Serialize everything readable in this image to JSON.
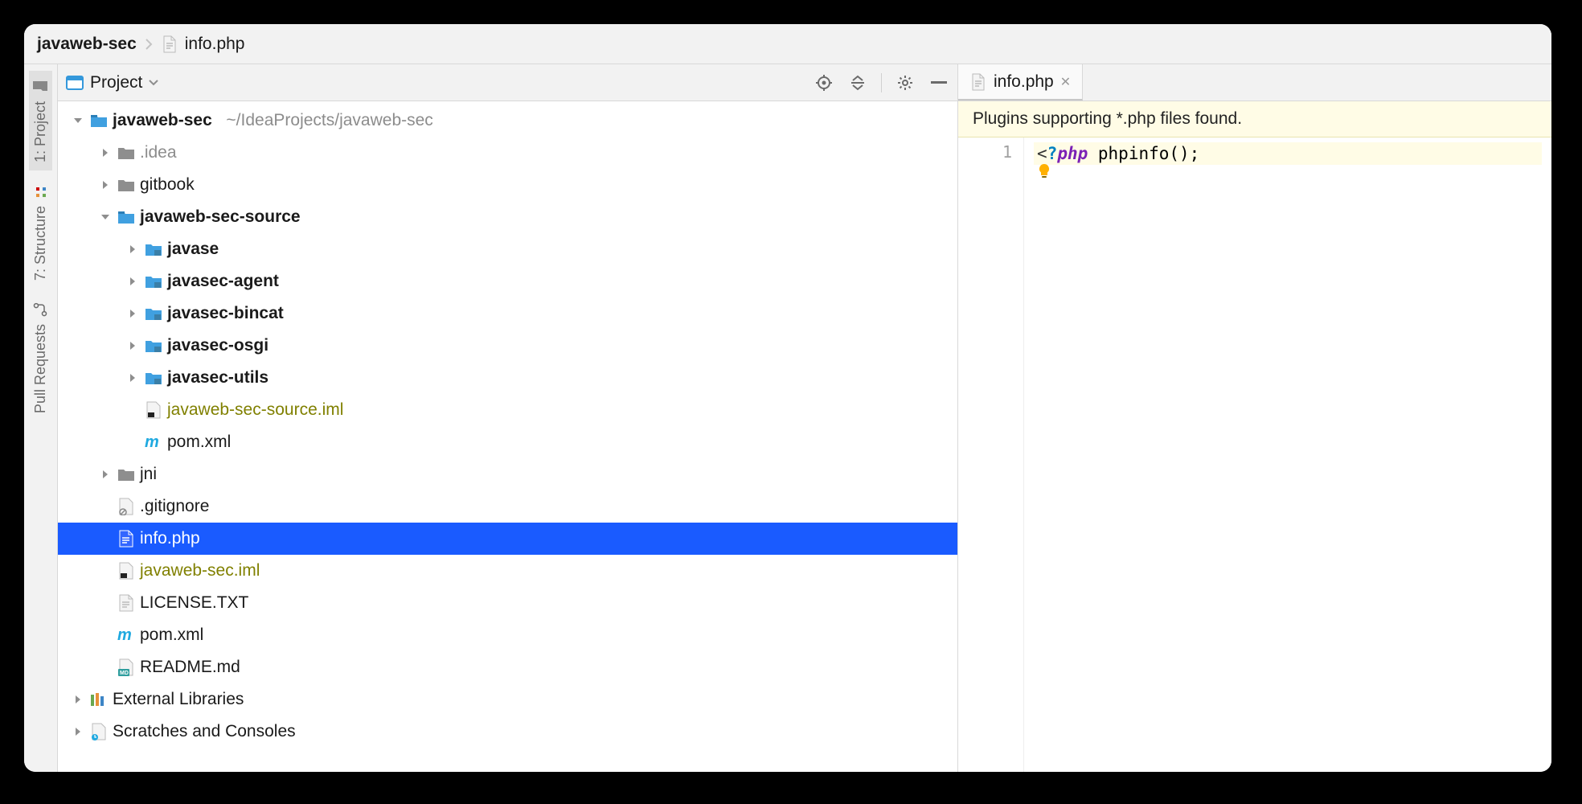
{
  "breadcrumb": {
    "project": "javaweb-sec",
    "file": "info.php"
  },
  "toolstrip": {
    "tabs": [
      {
        "label": "1: Project"
      },
      {
        "label": "7: Structure"
      },
      {
        "label": "Pull Requests"
      }
    ]
  },
  "project_panel": {
    "title": "Project",
    "tree": {
      "root": {
        "name": "javaweb-sec",
        "path": "~/IdeaProjects/javaweb-sec"
      },
      "items": [
        {
          "name": ".idea",
          "depth": 1,
          "expanded": false,
          "kind": "folder-gray",
          "muted": true
        },
        {
          "name": "gitbook",
          "depth": 1,
          "expanded": false,
          "kind": "folder-gray"
        },
        {
          "name": "javaweb-sec-source",
          "depth": 1,
          "expanded": true,
          "kind": "folder-blue",
          "bold": true
        },
        {
          "name": "javase",
          "depth": 2,
          "expanded": false,
          "kind": "module",
          "bold": true
        },
        {
          "name": "javasec-agent",
          "depth": 2,
          "expanded": false,
          "kind": "module",
          "bold": true
        },
        {
          "name": "javasec-bincat",
          "depth": 2,
          "expanded": false,
          "kind": "module",
          "bold": true
        },
        {
          "name": "javasec-osgi",
          "depth": 2,
          "expanded": false,
          "kind": "module",
          "bold": true
        },
        {
          "name": "javasec-utils",
          "depth": 2,
          "expanded": false,
          "kind": "module",
          "bold": true
        },
        {
          "name": "javaweb-sec-source.iml",
          "depth": 2,
          "leaf": true,
          "kind": "iml",
          "olive": true
        },
        {
          "name": "pom.xml",
          "depth": 2,
          "leaf": true,
          "kind": "maven"
        },
        {
          "name": "jni",
          "depth": 1,
          "expanded": false,
          "kind": "folder-gray"
        },
        {
          "name": ".gitignore",
          "depth": 1,
          "leaf": true,
          "kind": "gitignore"
        },
        {
          "name": "info.php",
          "depth": 1,
          "leaf": true,
          "kind": "file",
          "selected": true
        },
        {
          "name": "javaweb-sec.iml",
          "depth": 1,
          "leaf": true,
          "kind": "iml",
          "olive": true
        },
        {
          "name": "LICENSE.TXT",
          "depth": 1,
          "leaf": true,
          "kind": "file"
        },
        {
          "name": "pom.xml",
          "depth": 1,
          "leaf": true,
          "kind": "maven"
        },
        {
          "name": "README.md",
          "depth": 1,
          "leaf": true,
          "kind": "md"
        }
      ],
      "trailing": [
        {
          "name": "External Libraries",
          "kind": "libraries"
        },
        {
          "name": "Scratches and Consoles",
          "kind": "scratches"
        }
      ]
    }
  },
  "editor": {
    "tab": {
      "label": "info.php"
    },
    "banner": "Plugins supporting *.php files found.",
    "gutter_line": "1",
    "code": {
      "open": "<",
      "q": "?",
      "kw": "php",
      "body": " phpinfo();"
    }
  }
}
